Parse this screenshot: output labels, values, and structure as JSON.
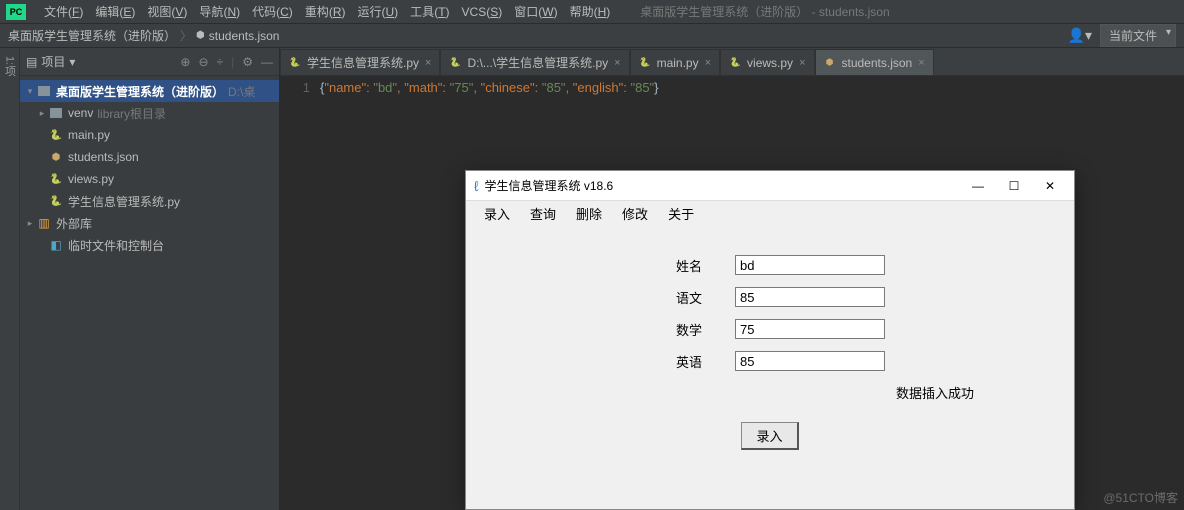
{
  "menubar": {
    "items": [
      {
        "label": "文件",
        "mn": "F"
      },
      {
        "label": "编辑",
        "mn": "E"
      },
      {
        "label": "视图",
        "mn": "V"
      },
      {
        "label": "导航",
        "mn": "N"
      },
      {
        "label": "代码",
        "mn": "C"
      },
      {
        "label": "重构",
        "mn": "R"
      },
      {
        "label": "运行",
        "mn": "U"
      },
      {
        "label": "工具",
        "mn": "T"
      },
      {
        "label": "VCS",
        "mn": "S"
      },
      {
        "label": "窗口",
        "mn": "W"
      },
      {
        "label": "帮助",
        "mn": "H"
      }
    ],
    "title": "桌面版学生管理系统（进阶版） - students.json"
  },
  "breadcrumb": {
    "seg1": "桌面版学生管理系统（进阶版）",
    "seg2": "students.json",
    "file_selector": "当前文件"
  },
  "panel": {
    "title": "项目",
    "icons": [
      "⊕",
      "⊖",
      "÷",
      "⚙",
      "—"
    ]
  },
  "tree": {
    "root": "桌面版学生管理系统（进阶版）",
    "root_path": "D:\\桌",
    "venv": "venv",
    "venv_hint": "library根目录",
    "files": [
      "main.py",
      "students.json",
      "views.py",
      "学生信息管理系统.py"
    ],
    "ext_lib": "外部库",
    "scratch": "临时文件和控制台"
  },
  "tabs": [
    {
      "label": "学生信息管理系统.py",
      "type": "py",
      "active": false
    },
    {
      "label": "D:\\...\\学生信息管理系统.py",
      "type": "py",
      "active": false
    },
    {
      "label": "main.py",
      "type": "py",
      "active": false
    },
    {
      "label": "views.py",
      "type": "py",
      "active": false
    },
    {
      "label": "students.json",
      "type": "json",
      "active": true
    }
  ],
  "editor": {
    "line_no": "1",
    "json_pairs": [
      {
        "k": "\"name\"",
        "v": "\"bd\""
      },
      {
        "k": "\"math\"",
        "v": "\"75\""
      },
      {
        "k": "\"chinese\"",
        "v": "\"85\""
      },
      {
        "k": "\"english\"",
        "v": "\"85\""
      }
    ]
  },
  "dialog": {
    "title": "学生信息管理系统 v18.6",
    "menu": [
      "录入",
      "查询",
      "删除",
      "修改",
      "关于"
    ],
    "fields": [
      {
        "label": "姓名",
        "value": "bd"
      },
      {
        "label": "语文",
        "value": "85"
      },
      {
        "label": "数学",
        "value": "75"
      },
      {
        "label": "英语",
        "value": "85"
      }
    ],
    "status": "数据插入成功",
    "submit": "录入"
  },
  "watermark": "@51CTO博客"
}
